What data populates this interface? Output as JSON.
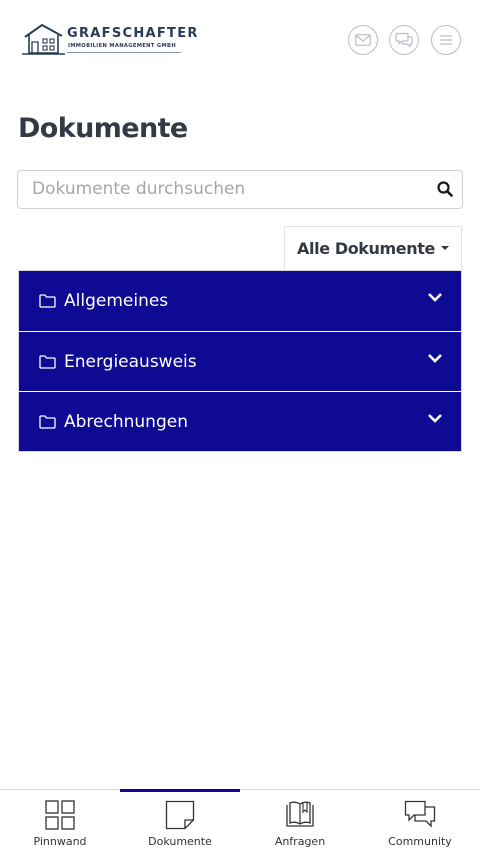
{
  "header": {
    "logo": {
      "title": "GRAFSCHAFTER",
      "subtitle": "IMMOBILIEN MANAGEMENT GMBH"
    },
    "icons": [
      "mail-icon",
      "chat-icon",
      "menu-icon"
    ]
  },
  "page": {
    "title": "Dokumente"
  },
  "search": {
    "placeholder": "Dokumente durchsuchen",
    "value": ""
  },
  "filter": {
    "label": "Alle Dokumente"
  },
  "folders": [
    {
      "label": "Allgemeines"
    },
    {
      "label": "Energieausweis"
    },
    {
      "label": "Abrechnungen"
    }
  ],
  "nav": {
    "items": [
      {
        "label": "Pinnwand",
        "icon": "grid-icon"
      },
      {
        "label": "Dokumente",
        "icon": "document-icon"
      },
      {
        "label": "Anfragen",
        "icon": "book-icon"
      },
      {
        "label": "Community",
        "icon": "chat-bubbles-icon"
      }
    ],
    "active": "Dokumente"
  },
  "colors": {
    "accent": "#0e0a94",
    "text": "#333a45",
    "border": "#cfd3d9"
  }
}
